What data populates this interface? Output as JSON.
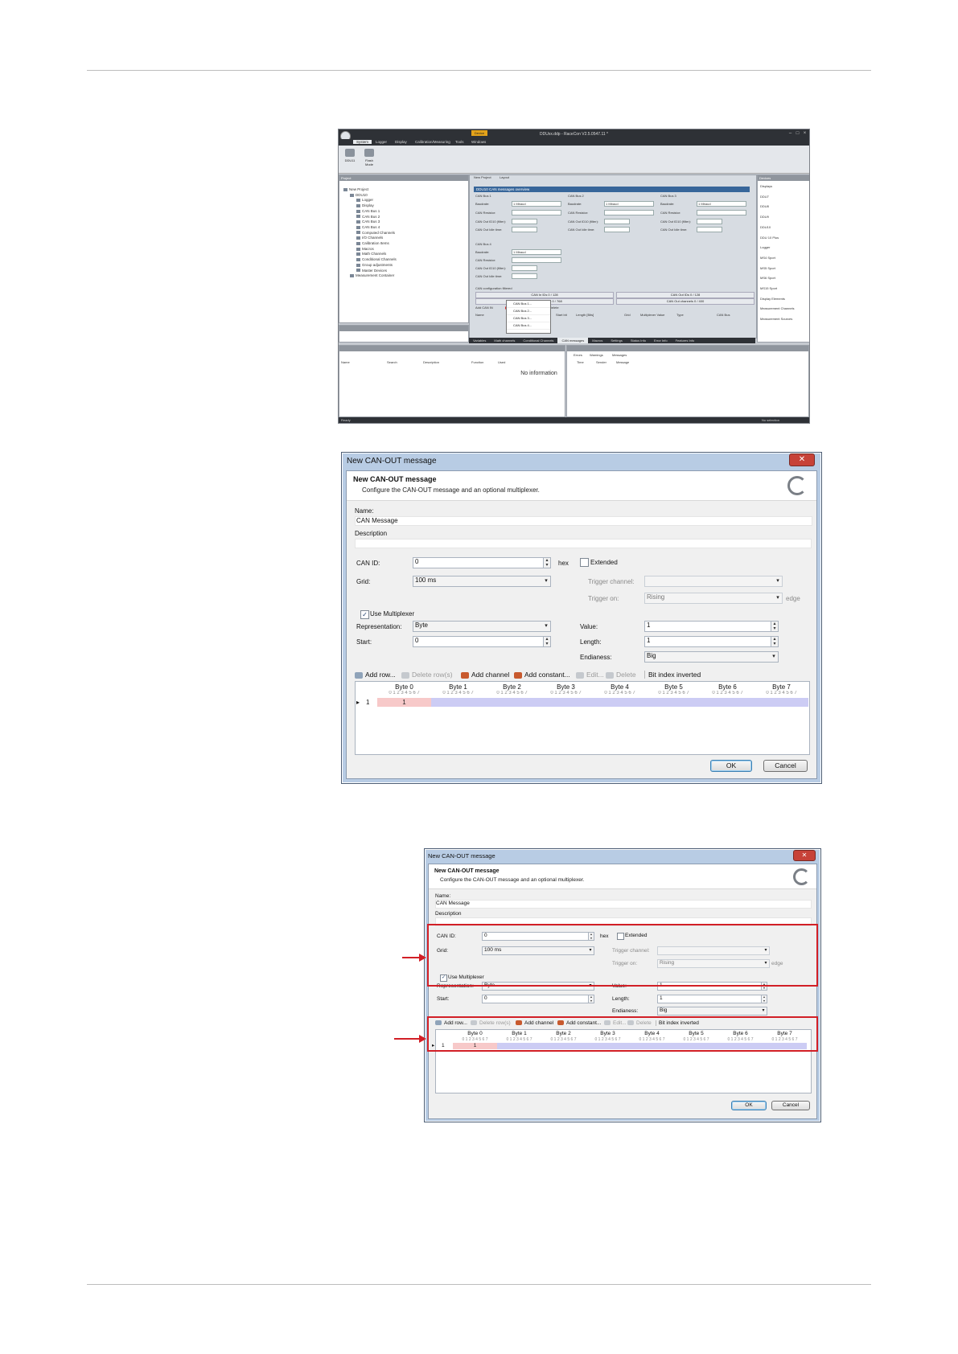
{
  "screenshot1": {
    "title": "DDUxx.ddp - RaceCon V2.5.0547.11 *",
    "highlight_tab": "Device",
    "menu": [
      "System",
      "Logger",
      "Display",
      "Calibration/Measuring",
      "Tools",
      "Windows"
    ],
    "ribbon": [
      "DDU11",
      "Flash Mode"
    ],
    "project_panel_title": "Project",
    "tree": [
      "New Project",
      "DDU10",
      "Logger",
      "Display",
      "CAN Bus 1",
      "CAN Bus 2",
      "CAN Bus 3",
      "CAN Bus 4",
      "Computed Channels",
      "I/O Channels",
      "Calibration Items",
      "Macros",
      "Math Channels",
      "Conditional Channels",
      "Group adjustments",
      "Master Devices",
      "Measurement Container"
    ],
    "doc_tabs": [
      "New Project",
      "Layout"
    ],
    "overview_header": "DDU10 CAN messages overview",
    "bus_titles": [
      "CAN Bus 1",
      "CAN Bus 2",
      "CAN Bus 3",
      "CAN Bus 4"
    ],
    "field_labels": [
      "Baudrate:",
      "CAN Resistor:",
      "CAN Out ID10 (filter):",
      "CAN Out Idle time:"
    ],
    "baud_value": "1 Mbaud",
    "config_title": "CAN configuration filtered",
    "config_bars": [
      "CAN In IDs 0 / 128",
      "CAN Out IDs 0 / 128",
      "CAN In channels 0 / 768",
      "CAN Out channels 0 / 400"
    ],
    "add_can_in": "Add CAN IN",
    "add_can_out": "Add CAN OUT",
    "delete_label": "Delete",
    "popup_items": [
      "CAN Bus 1...",
      "CAN Bus 2...",
      "CAN Bus 3...",
      "CAN Bus 4..."
    ],
    "grid_cols": [
      "Name",
      "Start bit",
      "Length [Bits]",
      "Grid",
      "Multiplexer Value",
      "Type",
      "CAN Bus"
    ],
    "right_panel_title": "Devices",
    "right_items": [
      "Displays",
      "DDU7",
      "DDU8",
      "DDU9",
      "DDU10",
      "DDU 10 Plus",
      "Logger",
      "MS4 Sport",
      "MS5 Sport",
      "MS6 Sport",
      "MS15 Sport",
      "Display Elements",
      "Measurement Channels",
      "Measurement Sources"
    ],
    "bottom_tabs": [
      "Variables",
      "Math channels",
      "Conditional Channels",
      "CAN messages",
      "Macros",
      "Settings",
      "Status Info",
      "Error Info",
      "Features Info"
    ],
    "info_tabs": [
      "Errors",
      "Warnings",
      "Messages"
    ],
    "info_cols": [
      "Time",
      "Sender",
      "Message"
    ],
    "props_cols": [
      "Name",
      "Search",
      "Description",
      "Function",
      "Used"
    ],
    "no_info": "No information",
    "status_left": "Ready",
    "status_right": "No selection"
  },
  "dialog_title": "New CAN-OUT message",
  "header_title": "New CAN-OUT message",
  "header_subtitle": "Configure the CAN-OUT message and an optional multiplexer.",
  "name_label": "Name:",
  "name_value": "CAN Message",
  "description_label": "Description",
  "description_value": "",
  "can_id_label": "CAN ID:",
  "can_id_value": "0",
  "hex_label": "hex",
  "extended_label": "Extended",
  "grid_label": "Grid:",
  "grid_value": "100 ms",
  "trigger_channel_label": "Trigger channel:",
  "trigger_channel_value": "",
  "trigger_on_label": "Trigger on:",
  "trigger_on_value": "Rising",
  "edge_label": "edge",
  "use_mux_label": "Use Multiplexer",
  "representation_label": "Representation:",
  "representation_value": "Byte",
  "start_label": "Start:",
  "start_value": "0",
  "value_label": "Value:",
  "value_value": "1",
  "length_label": "Length:",
  "length_value": "1",
  "endianess_label": "Endianess:",
  "endianess_value": "Big",
  "toolbar": {
    "add_row": "Add row...",
    "delete_rows": "Delete row(s)",
    "add_channel": "Add channel",
    "add_constant": "Add constant...",
    "edit": "Edit...",
    "delete": "Delete",
    "bit_index_inverted": "Bit index inverted"
  },
  "bytes": [
    "Byte 0",
    "Byte 1",
    "Byte 2",
    "Byte 3",
    "Byte 4",
    "Byte 5",
    "Byte 6",
    "Byte 7"
  ],
  "bit_indices": "0 1 2 3 4 5 6 7",
  "row_index": "1",
  "row_value": "1",
  "ok_label": "OK",
  "cancel_label": "Cancel",
  "colors": {
    "highlight": "#d21f26",
    "row_fill": "#ccccf4",
    "row_selected": "#f7c9c9",
    "dialog_frame": "#b8cce4"
  }
}
